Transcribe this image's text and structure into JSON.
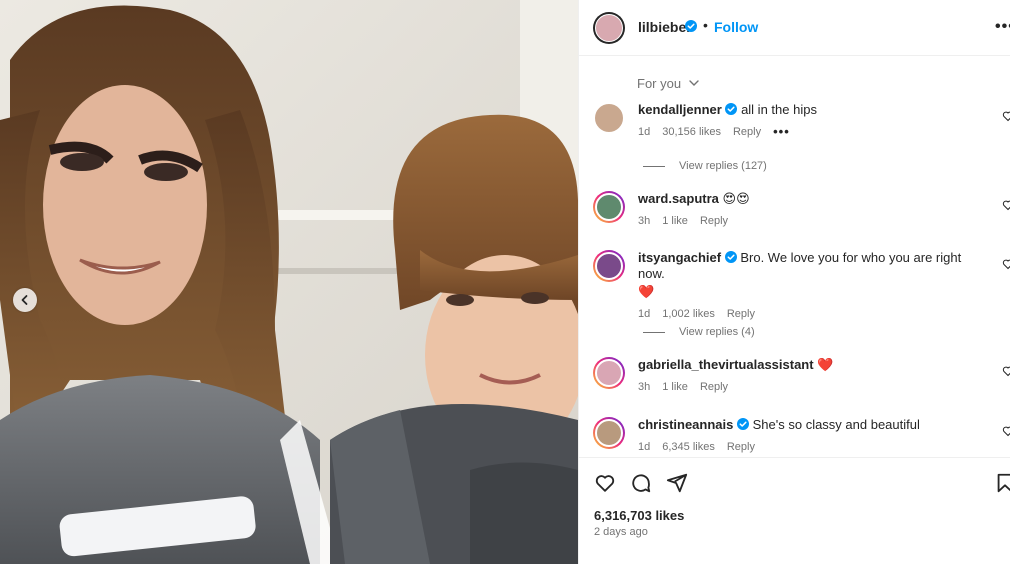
{
  "post": {
    "image_alt": "Two people in grey armored costumes posing together",
    "carousel_prev_icon": "chevron-left-icon"
  },
  "header": {
    "username": "lilbieber",
    "verified": true,
    "separator": "•",
    "follow_label": "Follow",
    "more_label": "•••"
  },
  "comments_filter": {
    "label": "For you"
  },
  "comments": [
    {
      "username": "kendalljenner",
      "verified": true,
      "text": "all in the hips",
      "heart_emoji": "",
      "age": "1d",
      "likes": "30,156 likes",
      "reply": "Reply",
      "more": "•••",
      "view_replies": "View replies (127)",
      "avatar_color": "#c9a88f",
      "ring": false
    },
    {
      "username": "ward.saputra",
      "verified": false,
      "text": "😍😍",
      "heart_emoji": "",
      "age": "3h",
      "likes": "1 like",
      "reply": "Reply",
      "more": "",
      "view_replies": "",
      "avatar_color": "#5f8a6e",
      "ring": true
    },
    {
      "username": "itsyangachief",
      "verified": true,
      "text": "Bro. We love you for who you are right now.",
      "heart_emoji": "❤️",
      "age": "1d",
      "likes": "1,002 likes",
      "reply": "Reply",
      "more": "",
      "view_replies": "View replies (4)",
      "avatar_color": "#7a4a8a",
      "ring": true
    },
    {
      "username": "gabriella_thevirtualassistant",
      "verified": false,
      "text": "",
      "heart_emoji": "❤️",
      "age": "3h",
      "likes": "1 like",
      "reply": "Reply",
      "more": "",
      "view_replies": "",
      "avatar_color": "#d9a6b4",
      "ring": true
    },
    {
      "username": "christineannais",
      "verified": true,
      "text": "She's so classy and beautiful",
      "heart_emoji": "",
      "age": "1d",
      "likes": "6,345 likes",
      "reply": "Reply",
      "more": "",
      "view_replies": "",
      "avatar_color": "#b89a7e",
      "ring": true
    }
  ],
  "actions": {
    "like_icon": "heart-icon",
    "comment_icon": "comment-icon",
    "share_icon": "share-icon",
    "save_icon": "bookmark-icon",
    "likes_count": "6,316,703 likes",
    "posted": "2 days ago"
  },
  "colors": {
    "link": "#0095f6",
    "text": "#262626",
    "muted": "#737373",
    "heart": "#e0245e"
  }
}
